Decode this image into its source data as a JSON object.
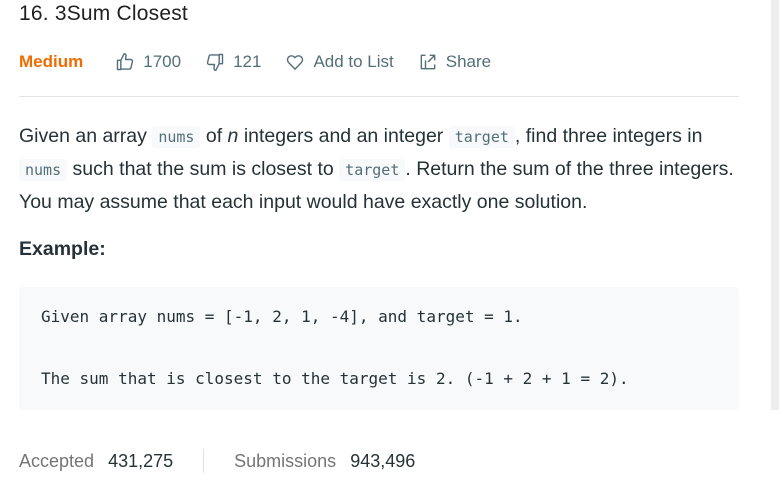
{
  "problem": {
    "title": "16. 3Sum Closest",
    "difficulty": "Medium",
    "likes": "1700",
    "dislikes": "121",
    "add_to_list_label": "Add to List",
    "share_label": "Share"
  },
  "description": {
    "p1": "Given an array ",
    "code_nums_1": "nums",
    "p2": " of ",
    "var_n": "n",
    "p3": " integers and an integer ",
    "code_target_1": "target",
    "p4": ", find three integers in ",
    "code_nums_2": "nums",
    "p5": " such that the sum is closest to ",
    "code_target_2": "target",
    "p6": ". Return the sum of the three integers. You may assume that each input would have exactly one solution."
  },
  "example": {
    "heading": "Example:",
    "line1": "Given array nums = [-1, 2, 1, -4], and target = 1.",
    "line2": "The sum that is closest to the target is 2. (-1 + 2 + 1 = 2)."
  },
  "stats": {
    "accepted_label": "Accepted",
    "accepted_value": "431,275",
    "submissions_label": "Submissions",
    "submissions_value": "943,496"
  },
  "colors": {
    "difficulty_medium": "#ef6c00",
    "code_background": "#f7f9fa",
    "text": "#263238",
    "muted": "#546e7a"
  },
  "icons": {
    "like": "thumbs-up-icon",
    "dislike": "thumbs-down-icon",
    "add_to_list": "heart-icon",
    "share": "share-icon"
  }
}
